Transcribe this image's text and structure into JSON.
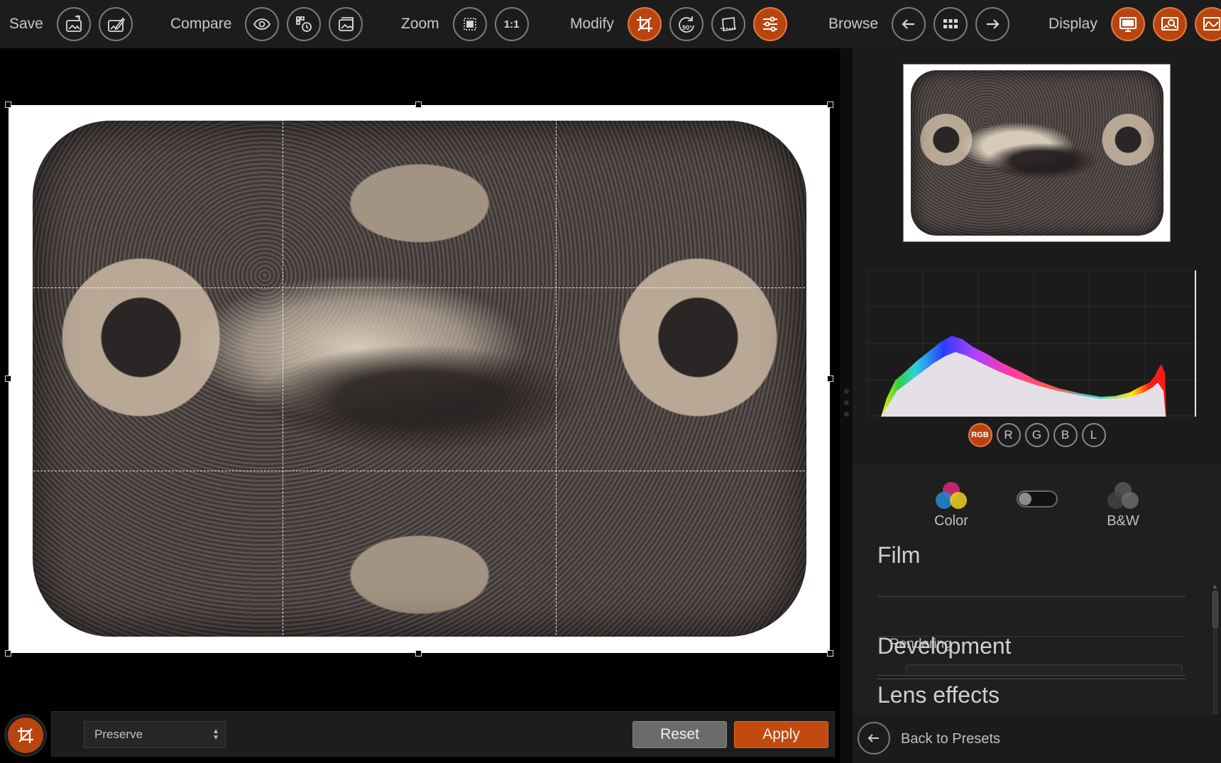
{
  "toolbar": {
    "save": {
      "label": "Save"
    },
    "compare": {
      "label": "Compare"
    },
    "zoom": {
      "label": "Zoom",
      "one_to_one": "1:1"
    },
    "modify": {
      "label": "Modify",
      "rotate_text": "90°"
    },
    "browse": {
      "label": "Browse"
    },
    "display": {
      "label": "Display"
    }
  },
  "crop_bar": {
    "aspect_option": "Preserve",
    "reset_label": "Reset",
    "apply_label": "Apply"
  },
  "histogram": {
    "channels": [
      "RGB",
      "R",
      "G",
      "B",
      "L"
    ],
    "active_channel": "RGB"
  },
  "adjustments": {
    "mode_color_label": "Color",
    "mode_bw_label": "B&W",
    "color_mode_enabled": true,
    "sections": {
      "film": "Film",
      "film_sub": "Rendering",
      "development": "Development",
      "lens_effects": "Lens effects"
    }
  },
  "footer": {
    "back_label": "Back to Presets"
  },
  "colors": {
    "accent": "#b8450f",
    "accent_border": "#e2793f"
  },
  "icons": {
    "save": [
      "export-image-icon",
      "edit-image-icon"
    ],
    "compare": [
      "eye-icon",
      "history-icon",
      "images-icon"
    ],
    "zoom": [
      "fit-icon",
      "actual-size-icon"
    ],
    "modify": [
      "crop-icon",
      "rotate-icon",
      "straighten-icon",
      "sliders-icon"
    ],
    "browse": [
      "arrow-left-icon",
      "grid-icon",
      "arrow-right-icon"
    ],
    "display": [
      "monitor-icon",
      "preview-icon",
      "histogram-icon"
    ]
  }
}
